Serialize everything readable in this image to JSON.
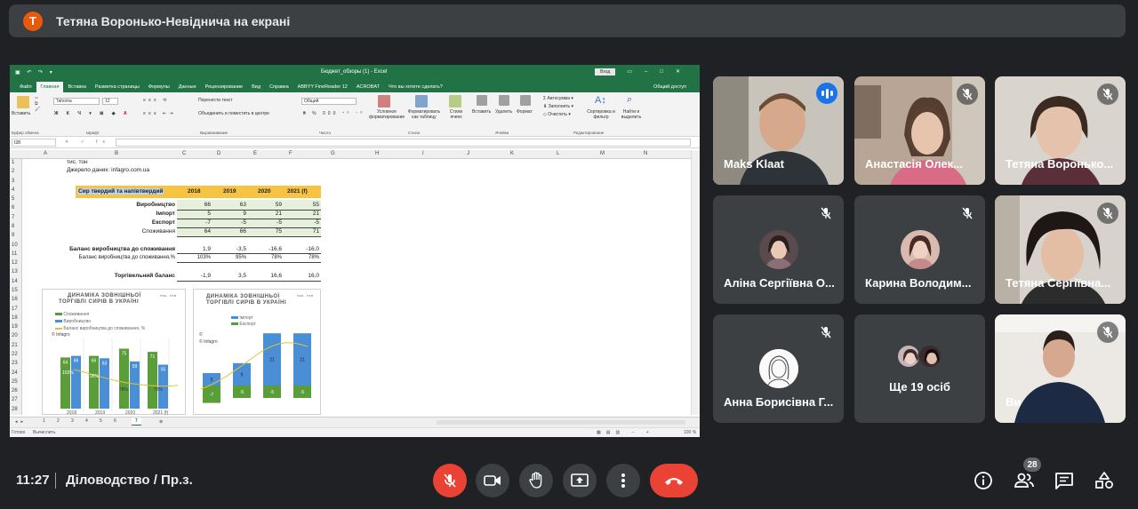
{
  "presenter_banner": {
    "avatar_letter": "T",
    "text": "Тетяна Воронько-Невіднича на екрані"
  },
  "excel": {
    "file_title": "Бюджет_обзоры (1) - Excel",
    "login_button": "Вход",
    "ribbon_tabs": [
      "Файл",
      "Главная",
      "Вставка",
      "Разметка страницы",
      "Формулы",
      "Данные",
      "Рецензирование",
      "Вид",
      "Справка",
      "ABBYY FineReader 12",
      "ACROBAT",
      "Что вы хотите сделать?"
    ],
    "active_tab": "Главная",
    "share": "Общий доступ",
    "ribbon": {
      "paste": "Вставить",
      "font_name": "Tahoma",
      "font_size": "12",
      "wrap_text": "Перенести текст",
      "merge": "Объединить и поместить в центре",
      "number_format": "Общий",
      "cond_format": "Условное форматирование",
      "format_table": "Форматировать как таблицу",
      "cell_styles": "Стили ячеек",
      "insert": "Вставить",
      "delete": "Удалить",
      "format": "Формат",
      "autosum": "Автосумма",
      "fill": "Заполнить",
      "clear": "Очистить",
      "sort_filter": "Сортировка и фильтр",
      "find_select": "Найти и выделить",
      "groups": [
        "Буфер обмена",
        "Шрифт",
        "Выравнивание",
        "Число",
        "Стили",
        "Ячейки",
        "Редактирование"
      ]
    },
    "name_box": "I28",
    "columns": [
      "A",
      "B",
      "C",
      "D",
      "E",
      "F",
      "G",
      "H",
      "I",
      "J",
      "K",
      "L",
      "M",
      "N"
    ],
    "rows": [
      "1",
      "2",
      "3",
      "4",
      "5",
      "6",
      "7",
      "8",
      "9",
      "10",
      "11",
      "12",
      "13",
      "14",
      "15",
      "16",
      "17",
      "18",
      "19",
      "20",
      "21",
      "22",
      "23",
      "24",
      "25",
      "26",
      "27",
      "28"
    ],
    "top_note_1": "тис. тон",
    "top_note_2": "Джерело даних: infagro.com.ua",
    "table": {
      "header": "Сир твердий та напівтвердий",
      "years": [
        "2018",
        "2019",
        "2020",
        "2021 (f)"
      ],
      "rows": [
        {
          "label": "Виробництво",
          "values": [
            "66",
            "63",
            "59",
            "55"
          ]
        },
        {
          "label": "Імпорт",
          "values": [
            "5",
            "9",
            "21",
            "21"
          ]
        },
        {
          "label": "Експорт",
          "values": [
            "-7",
            "-5",
            "-5",
            "-5"
          ]
        },
        {
          "label": "Споживання",
          "values": [
            "64",
            "66",
            "75",
            "71"
          ]
        }
      ],
      "balance_label": "Баланс виробництва до споживання",
      "balance_values": [
        "1,9",
        "-3,5",
        "-16,6",
        "-16,0"
      ],
      "balance_pct_label": "Баланс виробництва до споживання,%",
      "balance_pct_values": [
        "103%",
        "95%",
        "78%",
        "78%"
      ],
      "trade_label": "Торгівельний баланс",
      "trade_values": [
        "-1,9",
        "3,5",
        "16,6",
        "16,0"
      ]
    },
    "chart1": {
      "title_line1": "ДИНАМІКА ЗОВНІШНЬОЇ",
      "title_line2": "ТОРГІВЛІ СИРІВ В УКРАЇНІ",
      "unit": "тис. тон",
      "legend": [
        "Споживання",
        "Виробництво",
        "Баланс виробництва до споживання, %"
      ],
      "source": "© Infagro",
      "bars_labels": [
        "64",
        "66",
        "66",
        "63",
        "75",
        "59",
        "71",
        "55"
      ],
      "pct_labels": [
        "103%",
        "95%",
        "78%",
        "78%"
      ],
      "x_labels": [
        "2018",
        "2019",
        "2020",
        "2021 (f)"
      ]
    },
    "chart2": {
      "title_line1": "ДИНАМІКА ЗОВНІШНЬОЇ",
      "title_line2": "ТОРГІВЛІ СИРІВ В УКРАЇНІ",
      "unit": "тис. тон",
      "legend": [
        "Імпорт",
        "Експорт"
      ],
      "source": "© Infagro",
      "import_labels": [
        "5",
        "9",
        "21",
        "21"
      ],
      "export_labels": [
        "-7",
        "-5",
        "-5",
        "-5"
      ]
    },
    "sheet_tabs": [
      "1",
      "2",
      "3",
      "4",
      "5",
      "6",
      "7"
    ],
    "active_sheet": "7",
    "status_left": "Готово",
    "status_calc": "Вычислить",
    "zoom": "100 %"
  },
  "participants": [
    {
      "name": "Maks Klaat",
      "state": "speaking",
      "has_video": true
    },
    {
      "name": "Анастасія Олек...",
      "state": "muted",
      "has_video": true
    },
    {
      "name": "Тетяна Воронько...",
      "state": "muted",
      "has_video": true
    },
    {
      "name": "Аліна Сергіївна О...",
      "state": "muted",
      "has_video": false
    },
    {
      "name": "Карина Володим...",
      "state": "muted",
      "has_video": false
    },
    {
      "name": "Тетяна Сергіївна...",
      "state": "muted",
      "has_video": true
    },
    {
      "name": "Анна Борисівна Г...",
      "state": "muted",
      "has_video": false
    },
    {
      "name": "Ще 19 осіб",
      "state": "others",
      "has_video": false
    },
    {
      "name": "Ви",
      "state": "muted",
      "has_video": true
    }
  ],
  "bottom_bar": {
    "time": "11:27",
    "meeting_title": "Діловодство / Пр.з.",
    "participants_count": "28"
  },
  "colors": {
    "accent_red": "#ea4335",
    "meet_dark": "#202124",
    "tile_bg": "#3c4043",
    "excel_green": "#217346",
    "speaking_blue": "#1a73e8"
  }
}
